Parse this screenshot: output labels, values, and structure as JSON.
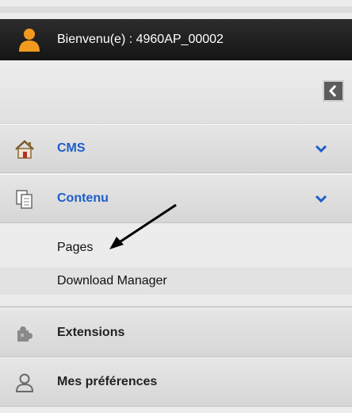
{
  "header": {
    "welcome_text": "Bienvenu(e) : 4960AP_00002",
    "user_icon": "user-icon"
  },
  "sidebar": {
    "collapse_icon": "chevron-left-icon",
    "menu": [
      {
        "label": "CMS",
        "icon": "home-icon",
        "expanded": false
      },
      {
        "label": "Contenu",
        "icon": "documents-icon",
        "expanded": true
      },
      {
        "label": "Extensions",
        "icon": "puzzle-icon"
      },
      {
        "label": "Mes préférences",
        "icon": "person-icon"
      }
    ],
    "submenu": [
      {
        "label": "Pages"
      },
      {
        "label": "Download Manager"
      }
    ]
  },
  "colors": {
    "accent": "#1d5ec9",
    "user_icon": "#f39a1e",
    "header_bg": "#1e1e1e"
  }
}
